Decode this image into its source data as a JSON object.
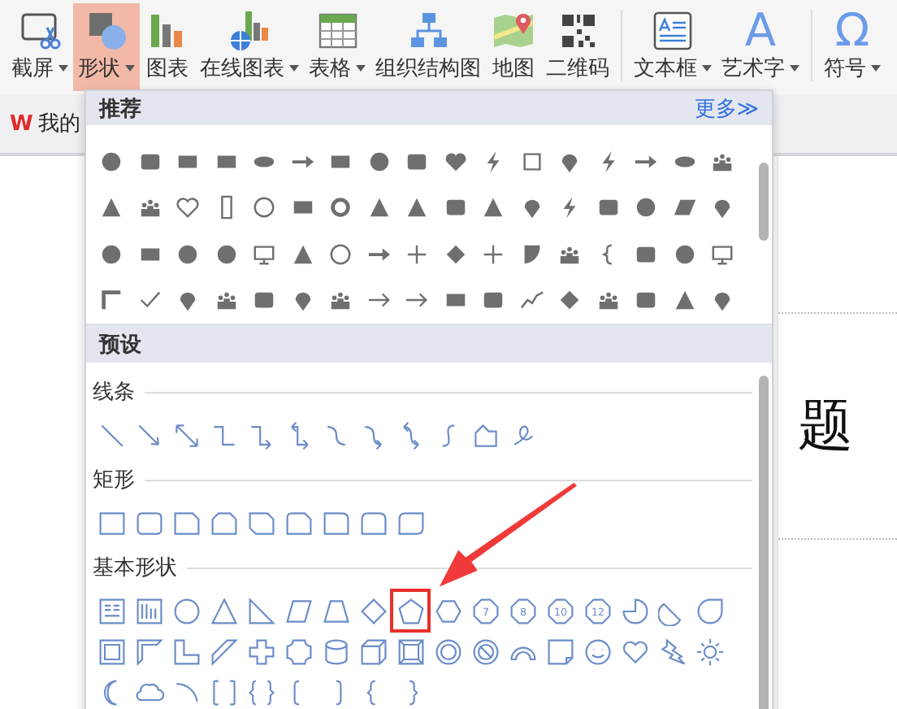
{
  "toolbar": {
    "groups": [
      {
        "items": [
          {
            "label": "截屏",
            "dropdown": true,
            "selected": false
          },
          {
            "label": "形状",
            "dropdown": true,
            "selected": true
          },
          {
            "label": "图表",
            "dropdown": false,
            "selected": false
          },
          {
            "label": "在线图表",
            "dropdown": true,
            "selected": false
          },
          {
            "label": "表格",
            "dropdown": true,
            "selected": false
          },
          {
            "label": "组织结构图",
            "dropdown": false,
            "selected": false
          },
          {
            "label": "地图",
            "dropdown": false,
            "selected": false
          },
          {
            "label": "二维码",
            "dropdown": false,
            "selected": false
          }
        ]
      },
      {
        "items": [
          {
            "label": "文本框",
            "dropdown": true,
            "selected": false
          },
          {
            "label": "艺术字",
            "dropdown": true,
            "selected": false,
            "glyph": "A"
          }
        ]
      },
      {
        "items": [
          {
            "label": "符号",
            "dropdown": true,
            "selected": false,
            "glyph": "Ω"
          }
        ]
      }
    ]
  },
  "tab": {
    "logo": "W",
    "label": "我的"
  },
  "document": {
    "title_fragment": "题"
  },
  "shapes_menu": {
    "recommended": {
      "title": "推荐",
      "more_link": "更多≫"
    },
    "preset": {
      "title": "预设",
      "sections": [
        {
          "kind": "lines",
          "title": "线条"
        },
        {
          "kind": "rectangles",
          "title": "矩形"
        },
        {
          "kind": "basic",
          "title": "基本形状",
          "shapes": [
            {
              "selected": false
            },
            {
              "selected": false
            },
            {
              "selected": false
            },
            {
              "selected": false
            },
            {
              "selected": false
            },
            {
              "selected": false
            },
            {
              "selected": false
            },
            {
              "selected": false
            },
            {
              "selected": true
            },
            {
              "selected": false
            },
            {
              "selected": false,
              "label": "7"
            },
            {
              "selected": false,
              "label": "8"
            },
            {
              "selected": false,
              "label": "10"
            },
            {
              "selected": false,
              "label": "12"
            },
            {
              "selected": false
            },
            {
              "selected": false
            },
            {
              "selected": false
            },
            {
              "selected": false
            },
            {
              "selected": false
            },
            {
              "selected": false
            },
            {
              "selected": false
            },
            {
              "selected": false
            },
            {
              "selected": false
            },
            {
              "selected": false
            },
            {
              "selected": false
            },
            {
              "selected": false
            },
            {
              "selected": false
            },
            {
              "selected": false
            },
            {
              "selected": false
            },
            {
              "selected": false
            },
            {
              "selected": false
            },
            {
              "selected": false
            },
            {
              "selected": false
            },
            {
              "selected": false
            },
            {
              "selected": false
            },
            {
              "selected": false
            },
            {
              "selected": false
            },
            {
              "selected": false
            },
            {
              "selected": false
            },
            {
              "selected": false
            },
            {
              "selected": false
            },
            {
              "selected": false
            },
            {
              "selected": false
            }
          ]
        }
      ]
    }
  },
  "annotation": {
    "kind": "arrow"
  }
}
